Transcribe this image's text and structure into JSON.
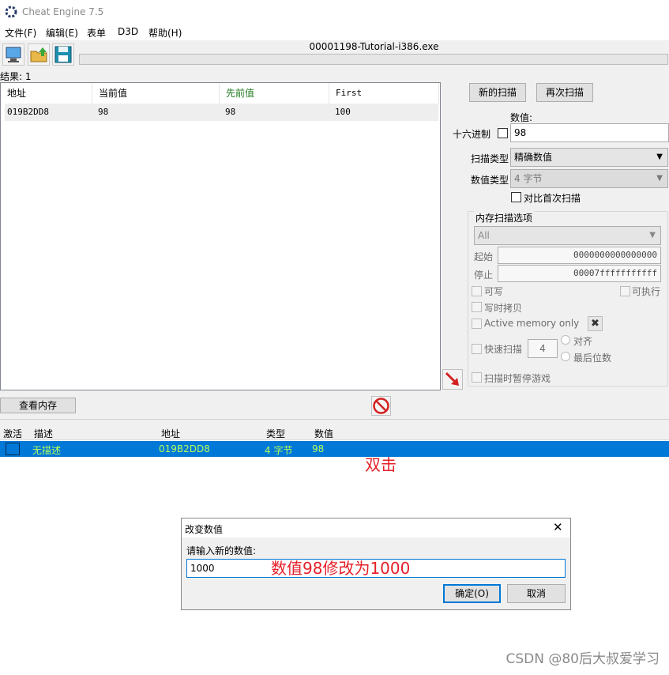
{
  "window": {
    "title": "Cheat Engine 7.5",
    "process_name": "00001198-Tutorial-i386.exe"
  },
  "menu": [
    "文件(F)",
    "编辑(E)",
    "表单",
    "D3D",
    "帮助(H)"
  ],
  "results_label": "结果: 1",
  "scan_list": {
    "headers": [
      "地址",
      "当前值",
      "先前值",
      "First"
    ],
    "rows": [
      {
        "address": "019B2DD8",
        "current": "98",
        "previous": "98",
        "first": "100"
      }
    ]
  },
  "scan_panel": {
    "new_scan": "新的扫描",
    "next_scan": "再次扫描",
    "value_label": "数值:",
    "hex_label": "十六进制",
    "value": "98",
    "scan_type_label": "扫描类型",
    "scan_type": "精确数值",
    "value_type_label": "数值类型",
    "value_type": "4 字节",
    "compare_first": "对比首次扫描",
    "mem_options_title": "内存扫描选项",
    "region": "All",
    "start_label": "起始",
    "start_value": "0000000000000000",
    "stop_label": "停止",
    "stop_value": "00007fffffffffff",
    "writable": "可写",
    "executable": "可执行",
    "copy_on_write": "写时拷贝",
    "active_memory_only": "Active memory only",
    "fast_scan": "快速扫描",
    "fast_scan_value": "4",
    "align": "对齐",
    "last_digits": "最后位数",
    "pause_game": "扫描时暂停游戏"
  },
  "view_memory": "查看内存",
  "address_list": {
    "headers": [
      "激活",
      "描述",
      "地址",
      "类型",
      "数值"
    ],
    "rows": [
      {
        "description": "无描述",
        "address": "019B2DD8",
        "type": "4 字节",
        "value": "98"
      }
    ]
  },
  "annotations": {
    "double_click": "双击",
    "change_note": "数值98修改为1000"
  },
  "dialog": {
    "title": "改变数值",
    "prompt": "请输入新的数值:",
    "input_value": "1000",
    "ok": "确定(O)",
    "cancel": "取消"
  },
  "watermark": "CSDN @80后大叔爱学习",
  "colors": {
    "selection": "#0078d7",
    "row_text": "#b4ff5a",
    "annotation": "#e5202a",
    "previous_header": "#1f7a1f"
  }
}
